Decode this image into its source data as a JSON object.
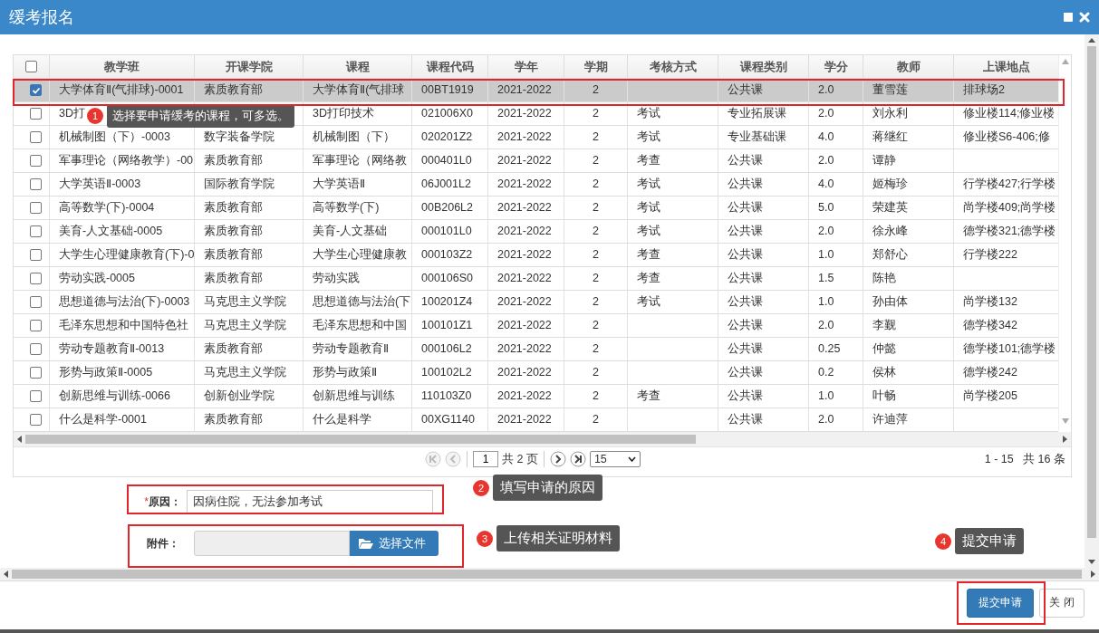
{
  "window": {
    "title": "缓考报名"
  },
  "table": {
    "all_selected": false,
    "columns": [
      "教学班",
      "开课学院",
      "课程",
      "课程代码",
      "学年",
      "学期",
      "考核方式",
      "课程类别",
      "学分",
      "教师",
      "上课地点"
    ],
    "rows": [
      {
        "selected": true,
        "cells": [
          "大学体育Ⅱ(气排球)-0001",
          "素质教育部",
          "大学体育Ⅱ(气排球",
          "00BT1919",
          "2021-2022",
          "2",
          "",
          "公共课",
          "2.0",
          "董雪莲",
          "排球场2"
        ]
      },
      {
        "selected": false,
        "cells": [
          "3D打",
          null,
          "3D打印技术",
          "021006X0",
          "2021-2022",
          "2",
          "考试",
          "专业拓展课",
          "2.0",
          "刘永利",
          "修业楼114;修业楼"
        ]
      },
      {
        "selected": false,
        "cells": [
          "机械制图（下）-0003",
          "数字装备学院",
          "机械制图（下）",
          "020201Z2",
          "2021-2022",
          "2",
          "考试",
          "专业基础课",
          "4.0",
          "蒋继红",
          "修业楼S6-406;修"
        ]
      },
      {
        "selected": false,
        "cells": [
          "军事理论（网络教学）-00",
          "素质教育部",
          "军事理论（网络教",
          "000401L0",
          "2021-2022",
          "2",
          "考查",
          "公共课",
          "2.0",
          "谭静",
          ""
        ]
      },
      {
        "selected": false,
        "cells": [
          "大学英语Ⅱ-0003",
          "国际教育学院",
          "大学英语Ⅱ",
          "06J001L2",
          "2021-2022",
          "2",
          "考试",
          "公共课",
          "4.0",
          "姬梅珍",
          "行学楼427;行学楼"
        ]
      },
      {
        "selected": false,
        "cells": [
          "高等数学(下)-0004",
          "素质教育部",
          "高等数学(下)",
          "00B206L2",
          "2021-2022",
          "2",
          "考试",
          "公共课",
          "5.0",
          "荣建英",
          "尚学楼409;尚学楼"
        ]
      },
      {
        "selected": false,
        "cells": [
          "美育-人文基础-0005",
          "素质教育部",
          "美育-人文基础",
          "000101L0",
          "2021-2022",
          "2",
          "考试",
          "公共课",
          "2.0",
          "徐永峰",
          "德学楼321;德学楼"
        ]
      },
      {
        "selected": false,
        "cells": [
          "大学生心理健康教育(下)-0",
          "素质教育部",
          "大学生心理健康教",
          "000103Z2",
          "2021-2022",
          "2",
          "考查",
          "公共课",
          "1.0",
          "郑舒心",
          "行学楼222"
        ]
      },
      {
        "selected": false,
        "cells": [
          "劳动实践-0005",
          "素质教育部",
          "劳动实践",
          "000106S0",
          "2021-2022",
          "2",
          "考查",
          "公共课",
          "1.5",
          "陈艳",
          ""
        ]
      },
      {
        "selected": false,
        "cells": [
          "思想道德与法治(下)-0003",
          "马克思主义学院",
          "思想道德与法治(下",
          "100201Z4",
          "2021-2022",
          "2",
          "考试",
          "公共课",
          "1.0",
          "孙由体",
          "尚学楼132"
        ]
      },
      {
        "selected": false,
        "cells": [
          "毛泽东思想和中国特色社",
          "马克思主义学院",
          "毛泽东思想和中国",
          "100101Z1",
          "2021-2022",
          "2",
          "",
          "公共课",
          "2.0",
          "李觐",
          "德学楼342"
        ]
      },
      {
        "selected": false,
        "cells": [
          "劳动专题教育Ⅱ-0013",
          "素质教育部",
          "劳动专题教育Ⅱ",
          "000106L2",
          "2021-2022",
          "2",
          "",
          "公共课",
          "0.25",
          "仲懿",
          "德学楼101;德学楼"
        ]
      },
      {
        "selected": false,
        "cells": [
          "形势与政策Ⅱ-0005",
          "马克思主义学院",
          "形势与政策Ⅱ",
          "100102L2",
          "2021-2022",
          "2",
          "",
          "公共课",
          "0.2",
          "侯林",
          "德学楼242"
        ]
      },
      {
        "selected": false,
        "cells": [
          "创新思维与训练-0066",
          "创新创业学院",
          "创新思维与训练",
          "110103Z0",
          "2021-2022",
          "2",
          "考查",
          "公共课",
          "1.0",
          "叶畅",
          "尚学楼205"
        ]
      },
      {
        "selected": false,
        "cells": [
          "什么是科学-0001",
          "素质教育部",
          "什么是科学",
          "00XG1140",
          "2021-2022",
          "2",
          "",
          "公共课",
          "2.0",
          "许迪萍",
          ""
        ]
      }
    ]
  },
  "pager": {
    "page": "1",
    "total_pages": "共 2 页",
    "page_size": "15",
    "summary": "1 - 15   共 16 条"
  },
  "form": {
    "reason": {
      "required_mark": "*",
      "label": "原因：",
      "value": "因病住院，无法参加考试"
    },
    "attachment": {
      "label": "附件：",
      "button": "选择文件"
    }
  },
  "annotations": [
    {
      "number": "1",
      "text": "选择要申请缓考的课程，可多选。"
    },
    {
      "number": "2",
      "text": "填写申请的原因"
    },
    {
      "number": "3",
      "text": "上传相关证明材料"
    },
    {
      "number": "4",
      "text": "提交申请"
    }
  ],
  "buttons": [
    {
      "label": "提交申请",
      "kind": "primary"
    },
    {
      "label": "关 闭",
      "kind": "default"
    }
  ]
}
